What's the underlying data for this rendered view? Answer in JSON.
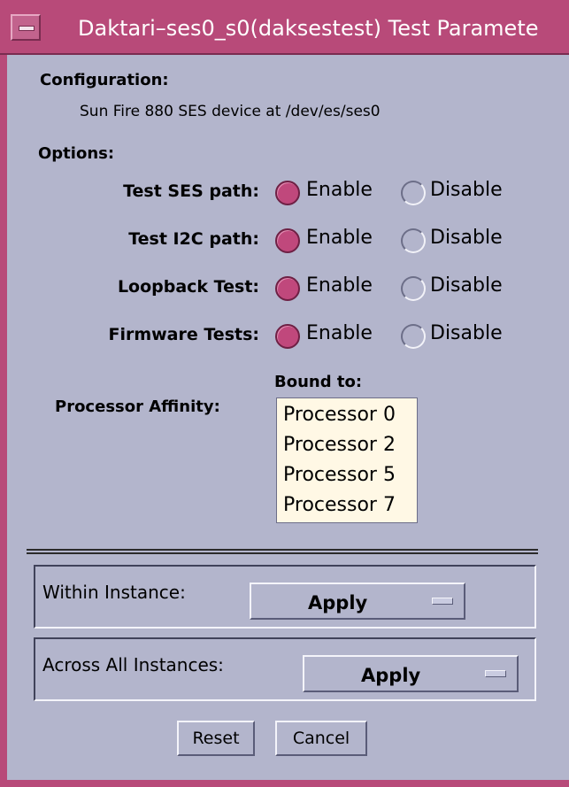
{
  "window": {
    "title": "Daktari–ses0_s0(daksestest) Test Paramete"
  },
  "configuration": {
    "heading": "Configuration:",
    "description": "Sun Fire 880 SES device at /dev/es/ses0"
  },
  "options": {
    "heading": "Options:",
    "items": [
      {
        "label": "Test SES path:",
        "enable": "Enable",
        "disable": "Disable",
        "selected": "Enable"
      },
      {
        "label": "Test I2C path:",
        "enable": "Enable",
        "disable": "Disable",
        "selected": "Enable"
      },
      {
        "label": "Loopback Test:",
        "enable": "Enable",
        "disable": "Disable",
        "selected": "Enable"
      },
      {
        "label": "Firmware Tests:",
        "enable": "Enable",
        "disable": "Disable",
        "selected": "Enable"
      }
    ]
  },
  "affinity": {
    "label": "Processor Affinity:",
    "bound_label": "Bound to:",
    "processors": [
      "Processor 0",
      "Processor 2",
      "Processor 5",
      "Processor 7"
    ]
  },
  "apply_panels": {
    "within": {
      "label": "Within Instance:",
      "value": "Apply"
    },
    "across": {
      "label": "Across All Instances:",
      "value": "Apply"
    }
  },
  "buttons": {
    "reset": "Reset",
    "cancel": "Cancel"
  },
  "colors": {
    "titlebar": "#b84a79",
    "background": "#b3b5cc",
    "radio_on": "#c0487c",
    "listbox": "#fff8e5"
  }
}
